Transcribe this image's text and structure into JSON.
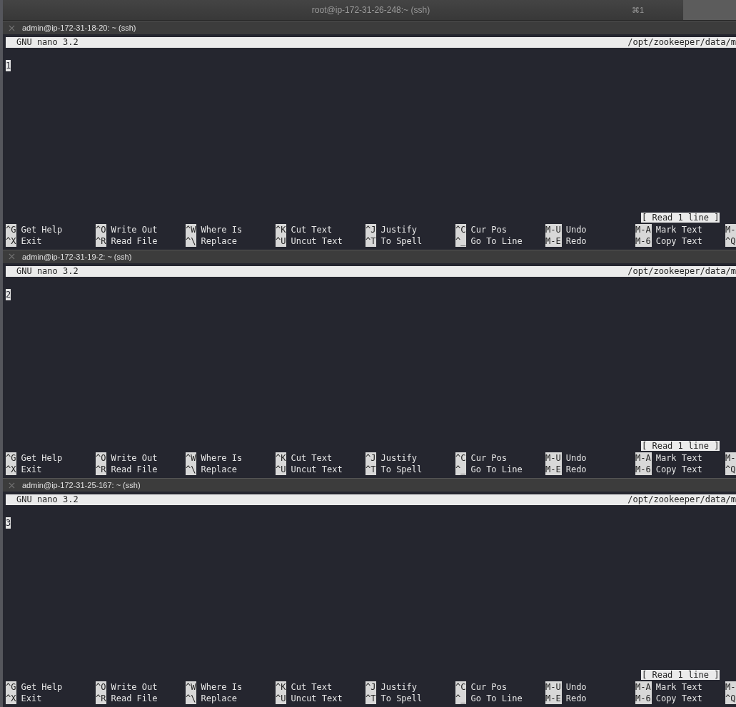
{
  "window": {
    "title": "root@ip-172-31-26-248:~ (ssh)",
    "tab_shortcut": "⌘1"
  },
  "panes": [
    {
      "title": "admin@ip-172-31-18-20: ~ (ssh)",
      "editor": {
        "version": "GNU nano 3.2",
        "path": "/opt/zookeeper/data/m",
        "lines": [
          {
            "text": "1",
            "cursor": true
          }
        ],
        "status": "[ Read 1 line ]",
        "shortcut_rows": [
          [
            {
              "key": "^G",
              "label": "Get Help"
            },
            {
              "key": "^O",
              "label": "Write Out"
            },
            {
              "key": "^W",
              "label": "Where Is"
            },
            {
              "key": "^K",
              "label": "Cut Text"
            },
            {
              "key": "^J",
              "label": "Justify"
            },
            {
              "key": "^C",
              "label": "Cur Pos"
            },
            {
              "key": "M-U",
              "label": "Undo"
            },
            {
              "key": "M-A",
              "label": "Mark Text"
            },
            {
              "key": "M-"
            }
          ],
          [
            {
              "key": "^X",
              "label": "Exit"
            },
            {
              "key": "^R",
              "label": "Read File"
            },
            {
              "key": "^\\",
              "label": "Replace"
            },
            {
              "key": "^U",
              "label": "Uncut Text"
            },
            {
              "key": "^T",
              "label": "To Spell"
            },
            {
              "key": "^_",
              "label": "Go To Line"
            },
            {
              "key": "M-E",
              "label": "Redo"
            },
            {
              "key": "M-6",
              "label": "Copy Text"
            },
            {
              "key": "^Q"
            }
          ]
        ]
      }
    },
    {
      "title": "admin@ip-172-31-19-2: ~ (ssh)",
      "editor": {
        "version": "GNU nano 3.2",
        "path": "/opt/zookeeper/data/m",
        "lines": [
          {
            "text": "2",
            "cursor": true
          }
        ],
        "status": "[ Read 1 line ]",
        "shortcut_rows": [
          [
            {
              "key": "^G",
              "label": "Get Help"
            },
            {
              "key": "^O",
              "label": "Write Out"
            },
            {
              "key": "^W",
              "label": "Where Is"
            },
            {
              "key": "^K",
              "label": "Cut Text"
            },
            {
              "key": "^J",
              "label": "Justify"
            },
            {
              "key": "^C",
              "label": "Cur Pos"
            },
            {
              "key": "M-U",
              "label": "Undo"
            },
            {
              "key": "M-A",
              "label": "Mark Text"
            },
            {
              "key": "M-"
            }
          ],
          [
            {
              "key": "^X",
              "label": "Exit"
            },
            {
              "key": "^R",
              "label": "Read File"
            },
            {
              "key": "^\\",
              "label": "Replace"
            },
            {
              "key": "^U",
              "label": "Uncut Text"
            },
            {
              "key": "^T",
              "label": "To Spell"
            },
            {
              "key": "^_",
              "label": "Go To Line"
            },
            {
              "key": "M-E",
              "label": "Redo"
            },
            {
              "key": "M-6",
              "label": "Copy Text"
            },
            {
              "key": "^Q"
            }
          ]
        ]
      }
    },
    {
      "title": "admin@ip-172-31-25-167: ~ (ssh)",
      "editor": {
        "version": "GNU nano 3.2",
        "path": "/opt/zookeeper/data/m",
        "lines": [
          {
            "text": "3",
            "cursor": true
          }
        ],
        "status": "[ Read 1 line ]",
        "shortcut_rows": [
          [
            {
              "key": "^G",
              "label": "Get Help"
            },
            {
              "key": "^O",
              "label": "Write Out"
            },
            {
              "key": "^W",
              "label": "Where Is"
            },
            {
              "key": "^K",
              "label": "Cut Text"
            },
            {
              "key": "^J",
              "label": "Justify"
            },
            {
              "key": "^C",
              "label": "Cur Pos"
            },
            {
              "key": "M-U",
              "label": "Undo"
            },
            {
              "key": "M-A",
              "label": "Mark Text"
            },
            {
              "key": "M-"
            }
          ],
          [
            {
              "key": "^X",
              "label": "Exit"
            },
            {
              "key": "^R",
              "label": "Read File"
            },
            {
              "key": "^\\",
              "label": "Replace"
            },
            {
              "key": "^U",
              "label": "Uncut Text"
            },
            {
              "key": "^T",
              "label": "To Spell"
            },
            {
              "key": "^_",
              "label": "Go To Line"
            },
            {
              "key": "M-E",
              "label": "Redo"
            },
            {
              "key": "M-6",
              "label": "Copy Text"
            },
            {
              "key": "^Q"
            }
          ]
        ]
      }
    }
  ]
}
